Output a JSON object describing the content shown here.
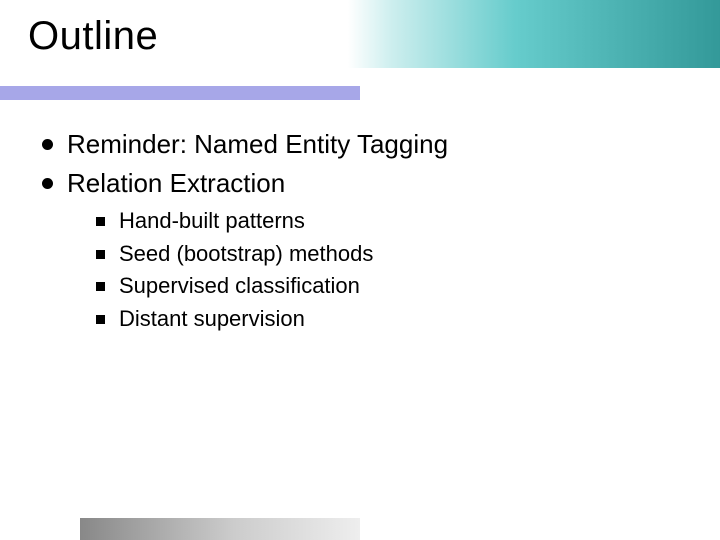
{
  "title": "Outline",
  "bullets": [
    {
      "text": "Reminder: Named Entity Tagging",
      "sub": []
    },
    {
      "text": "Relation Extraction",
      "sub": [
        "Hand-built patterns",
        "Seed (bootstrap) methods",
        "Supervised classification",
        "Distant supervision"
      ]
    }
  ]
}
